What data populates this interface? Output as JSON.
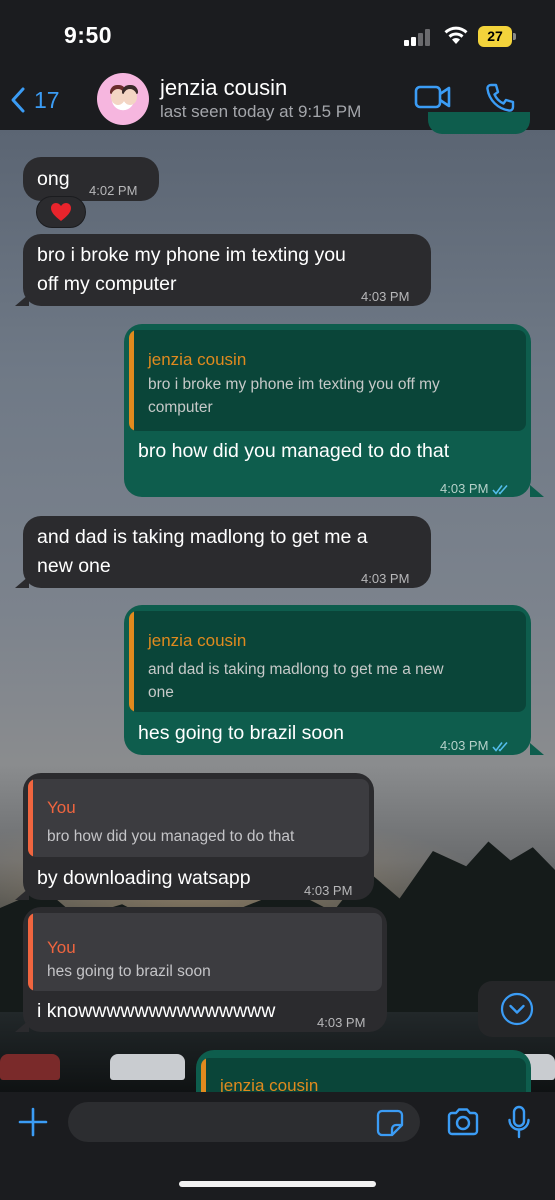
{
  "status": {
    "time": "9:50",
    "battery": "27"
  },
  "header": {
    "back_count": "17",
    "contact_name": "jenzia cousin",
    "last_seen": "last seen today at 9:15 PM"
  },
  "messages": [
    {
      "dir": "in",
      "text": "ong",
      "time": "4:02 PM",
      "reaction": "❤️"
    },
    {
      "dir": "in",
      "text_lines": [
        "bro i broke my phone im texting you",
        "off my computer"
      ],
      "time": "4:03 PM"
    },
    {
      "dir": "out",
      "quote_author": "jenzia cousin",
      "quote_lines": [
        "bro i broke my phone im texting you off my",
        "computer"
      ],
      "text": "bro how did you managed to do that",
      "time": "4:03 PM"
    },
    {
      "dir": "in",
      "text_lines": [
        "and dad is taking madlong to get me a",
        "new one"
      ],
      "time": "4:03 PM"
    },
    {
      "dir": "out",
      "quote_author": "jenzia cousin",
      "quote_lines": [
        "and dad is taking madlong to get me a new",
        "one"
      ],
      "text": "hes going to brazil soon",
      "time": "4:03 PM"
    },
    {
      "dir": "in",
      "quote_author": "You",
      "quote_text": "bro how did you managed to do that",
      "text": "by downloading watsapp",
      "time": "4:03 PM"
    },
    {
      "dir": "in",
      "quote_author": "You",
      "quote_text": "hes going to brazil soon",
      "text": "i knowwwwwwwwwwwwww",
      "time": "4:03 PM"
    },
    {
      "dir": "out",
      "quote_author": "jenzia cousin"
    }
  ],
  "colors": {
    "accent": "#3b9cf5",
    "incoming_bubble": "#2b2b2e",
    "outgoing_bubble": "#0e5d4d",
    "quote_contact": "#e08a1e",
    "quote_you": "#f0653f"
  }
}
